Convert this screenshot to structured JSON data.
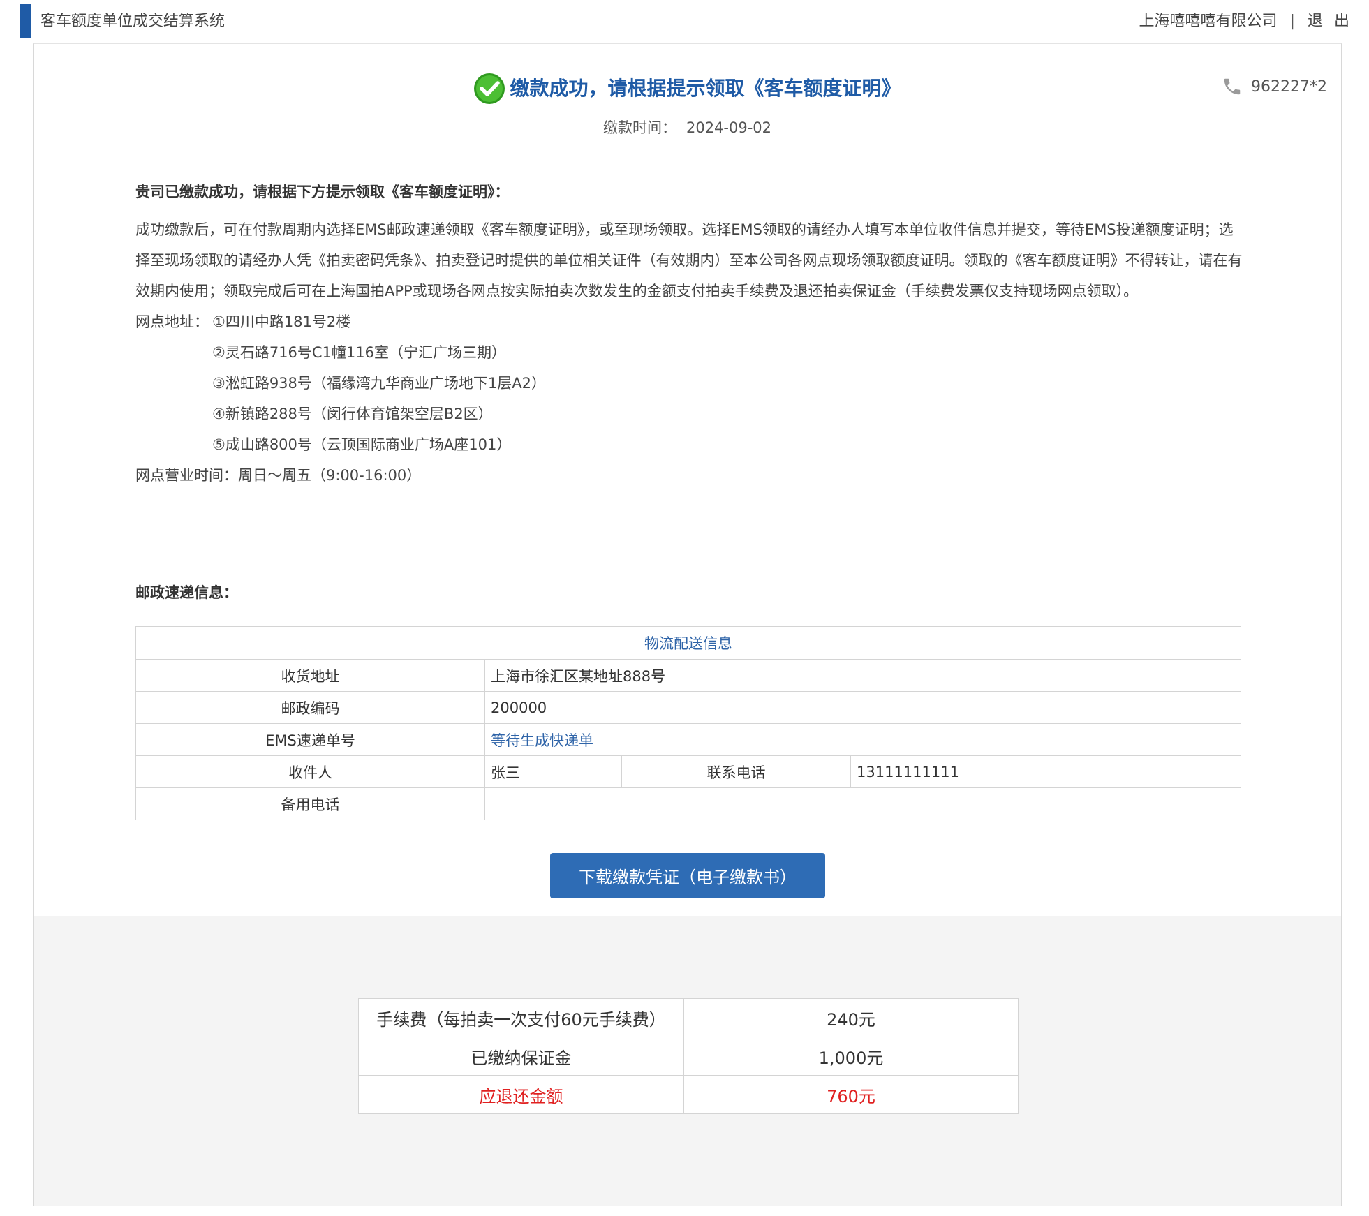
{
  "header": {
    "app_title": "客车额度单位成交结算系统",
    "company": "上海嘻嘻嘻有限公司",
    "separator": "|",
    "logout": "退出"
  },
  "hotline": {
    "icon": "phone-icon",
    "number": "962227*2"
  },
  "status": {
    "icon": "check-circle-icon",
    "title": "缴款成功，请根据提示领取《客车额度证明》",
    "time_label": "缴款时间：",
    "time_value": "2024-09-02"
  },
  "instructions": {
    "heading": "贵司已缴款成功，请根据下方提示领取《客车额度证明》：",
    "paragraph": "成功缴款后，可在付款周期内选择EMS邮政速递领取《客车额度证明》，或至现场领取。选择EMS领取的请经办人填写本单位收件信息并提交，等待EMS投递额度证明；选择至现场领取的请经办人凭《拍卖密码凭条》、拍卖登记时提供的单位相关证件（有效期内）至本公司各网点现场领取额度证明。领取的《客车额度证明》不得转让，请在有效期内使用；领取完成后可在上海国拍APP或现场各网点按实际拍卖次数发生的金额支付拍卖手续费及退还拍卖保证金（手续费发票仅支持现场网点领取）。",
    "address_label": "网点地址：",
    "addresses": [
      "①四川中路181号2楼",
      "②灵石路716号C1幢116室（宁汇广场三期）",
      "③淞虹路938号（福缘湾九华商业广场地下1层A2）",
      "④新镇路288号（闵行体育馆架空层B2区）",
      "⑤成山路800号（云顶国际商业广场A座101）"
    ],
    "hours": "网点营业时间：周日～周五（9:00-16:00）"
  },
  "postal": {
    "heading": "邮政速递信息：",
    "table_title": "物流配送信息",
    "address_label": "收货地址",
    "address_value": "上海市徐汇区某地址888号",
    "zip_label": "邮政编码",
    "zip_value": "200000",
    "ems_label": "EMS速递单号",
    "ems_value": "等待生成快递单",
    "recipient_label": "收件人",
    "recipient_value": "张三",
    "phone_label": "联系电话",
    "phone_value": "13111111111",
    "backup_phone_label": "备用电话",
    "backup_phone_value": ""
  },
  "download_button": "下载缴款凭证（电子缴款书）",
  "fees": {
    "fee_label": "手续费（每拍卖一次支付60元手续费）",
    "fee_value": "240元",
    "deposit_label": "已缴纳保证金",
    "deposit_value": "1,000元",
    "refund_label": "应退还金额",
    "refund_value": "760元"
  },
  "colors": {
    "accent": "#1f5ba6",
    "button": "#2e6cb5",
    "success": "#3fae29",
    "refund": "#e02020"
  }
}
